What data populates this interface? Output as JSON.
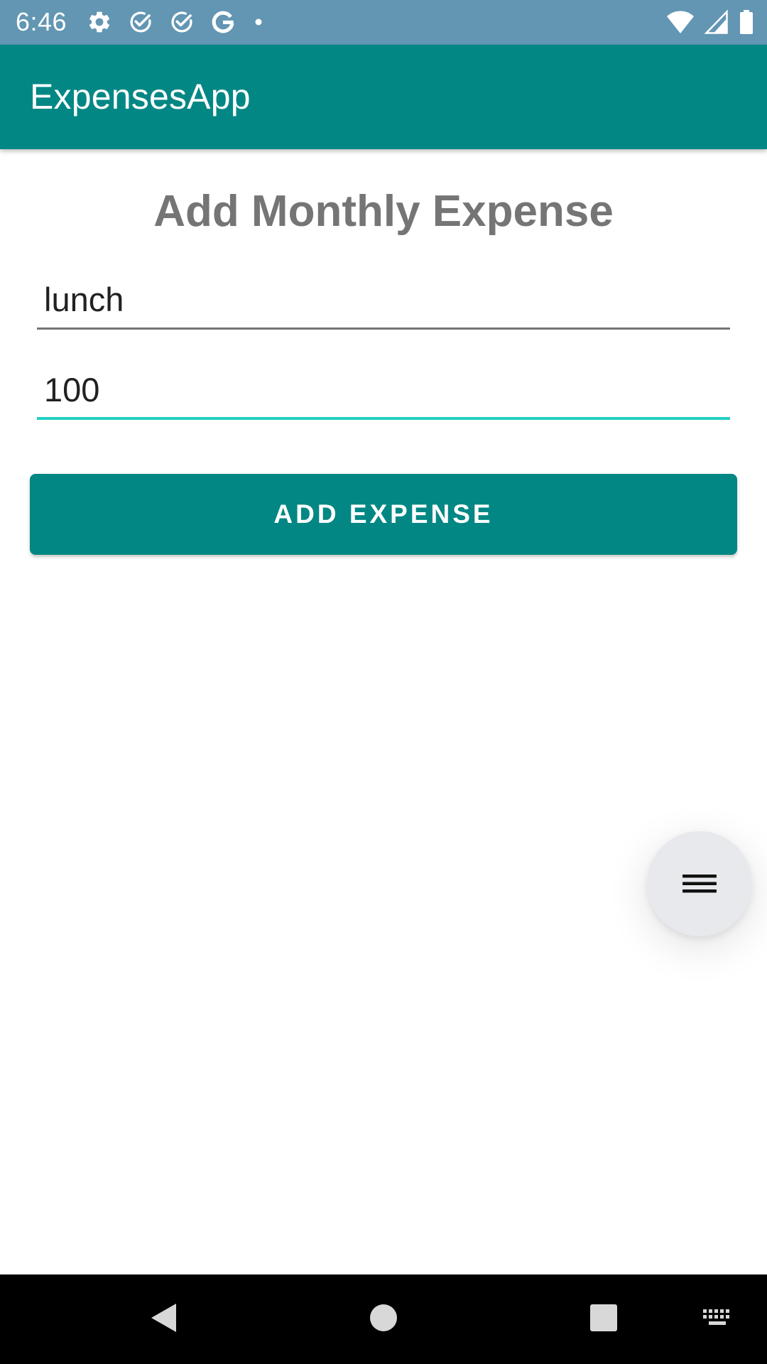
{
  "status_bar": {
    "time": "6:46",
    "left_icons": [
      "settings-icon",
      "check-circle-icon",
      "check-circle-icon",
      "google-icon",
      "dot-icon"
    ],
    "right_icons": [
      "wifi-icon",
      "cellular-signal-icon",
      "battery-icon"
    ]
  },
  "app_bar": {
    "title": "ExpensesApp",
    "color": "#028784"
  },
  "main": {
    "heading": "Add Monthly Expense",
    "name_field": {
      "value": "lunch",
      "placeholder": ""
    },
    "amount_field": {
      "value": "100",
      "placeholder": "",
      "focused": true
    },
    "add_button_label": "ADD EXPENSE",
    "fab_icon": "menu-icon"
  },
  "nav_bar": {
    "buttons": [
      "back-icon",
      "home-icon",
      "recents-icon",
      "keyboard-icon"
    ]
  },
  "colors": {
    "status_bar": "#6296b3",
    "primary": "#028784",
    "focus_accent": "#21cfc2",
    "heading_text": "#757575",
    "fab_background": "#e8e9ec"
  }
}
